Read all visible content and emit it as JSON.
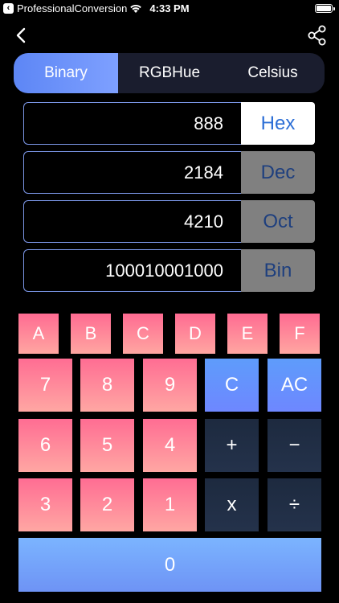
{
  "status": {
    "app_name": "ProfessionalConversion",
    "time": "4:33 PM"
  },
  "tabs": [
    {
      "label": "Binary",
      "active": true
    },
    {
      "label": "RGBHue",
      "active": false
    },
    {
      "label": "Celsius",
      "active": false
    }
  ],
  "rows": [
    {
      "value": "888",
      "unit": "Hex",
      "selected": true
    },
    {
      "value": "2184",
      "unit": "Dec",
      "selected": false
    },
    {
      "value": "4210",
      "unit": "Oct",
      "selected": false
    },
    {
      "value": "100010001000",
      "unit": "Bin",
      "selected": false
    }
  ],
  "hex_keys": [
    "A",
    "B",
    "C",
    "D",
    "E",
    "F"
  ],
  "num_keys": [
    "7",
    "8",
    "9",
    "6",
    "5",
    "4",
    "3",
    "2",
    "1"
  ],
  "control_keys": {
    "clear": "C",
    "all_clear": "AC"
  },
  "operator_keys": {
    "plus": "+",
    "minus": "−",
    "multiply": "x",
    "divide": "÷"
  },
  "zero_key": "0",
  "colors": {
    "tab_active": "#6e93f7",
    "hex_key": "#ff7f99",
    "control_key": "#6e90ff",
    "operator_key": "#1f2d44",
    "unit_selected": "#2d6fd6"
  }
}
